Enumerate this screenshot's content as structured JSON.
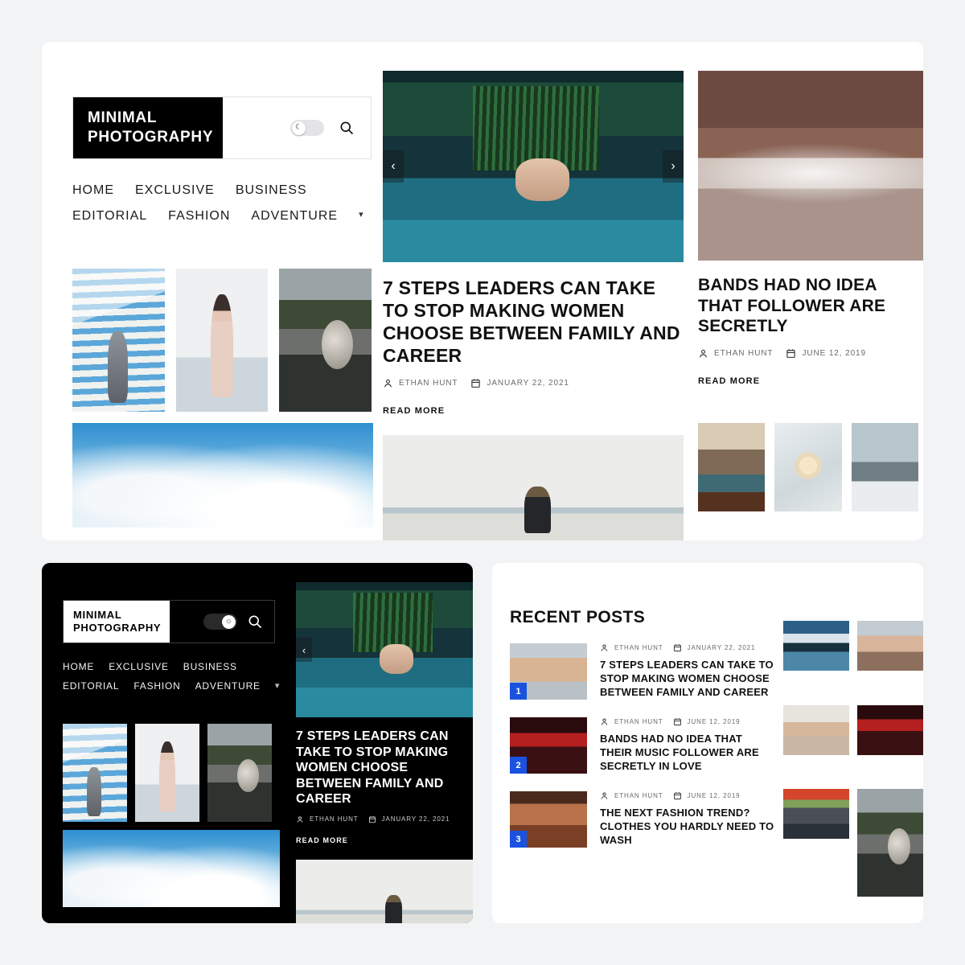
{
  "brand": {
    "line1": "MINIMAL",
    "line2": "PHOTOGRAPHY"
  },
  "icons": {
    "moon": "moon-icon",
    "sun": "sun-icon",
    "search": "search-icon",
    "chevron_down": "chevron-down-icon",
    "arrow_prev": "chevron-left-icon",
    "arrow_next": "chevron-right-icon",
    "author": "user-icon",
    "date": "calendar-icon"
  },
  "nav": {
    "items": [
      {
        "label": "HOME"
      },
      {
        "label": "EXCLUSIVE"
      },
      {
        "label": "BUSINESS"
      },
      {
        "label": "EDITORIAL"
      },
      {
        "label": "FASHION"
      },
      {
        "label": "ADVENTURE"
      }
    ],
    "has_dropdown": true
  },
  "toggle": {
    "light_state": "off",
    "dark_state": "on"
  },
  "carousel": {
    "prev_label": "‹",
    "next_label": "›"
  },
  "featured": {
    "title": "7 STEPS LEADERS CAN TAKE TO STOP MAKING WOMEN CHOOSE BETWEEN FAMILY AND CAREER",
    "author": "ETHAN HUNT",
    "date": "JANUARY 22, 2021",
    "read_more": "READ MORE"
  },
  "side_article": {
    "title": "BANDS HAD NO IDEA THAT FOLLOWER ARE SECRETLY",
    "author": "ETHAN HUNT",
    "date": "JUNE 12, 2019",
    "read_more": "READ MORE"
  },
  "recent": {
    "heading": "RECENT POSTS",
    "posts": [
      {
        "rank": "1",
        "author": "ETHAN HUNT",
        "date": "JANUARY 22, 2021",
        "title": "7 STEPS LEADERS CAN TAKE TO STOP MAKING WOMEN CHOOSE BETWEEN FAMILY AND CAREER"
      },
      {
        "rank": "2",
        "author": "ETHAN HUNT",
        "date": "JUNE 12, 2019",
        "title": "BANDS HAD NO IDEA THAT THEIR MUSIC FOLLOWER ARE SECRETLY IN LOVE"
      },
      {
        "rank": "3",
        "author": "ETHAN HUNT",
        "date": "JUNE 12, 2019",
        "title": "THE NEXT FASHION TREND? CLOTHES YOU HARDLY NEED TO WASH"
      }
    ]
  },
  "colors": {
    "page_background": "#f2f3f5",
    "card_background": "#ffffff",
    "dark_background": "#000000",
    "badge": "#1a52e0",
    "text": "#111111",
    "muted_text": "#6a6a6a"
  }
}
